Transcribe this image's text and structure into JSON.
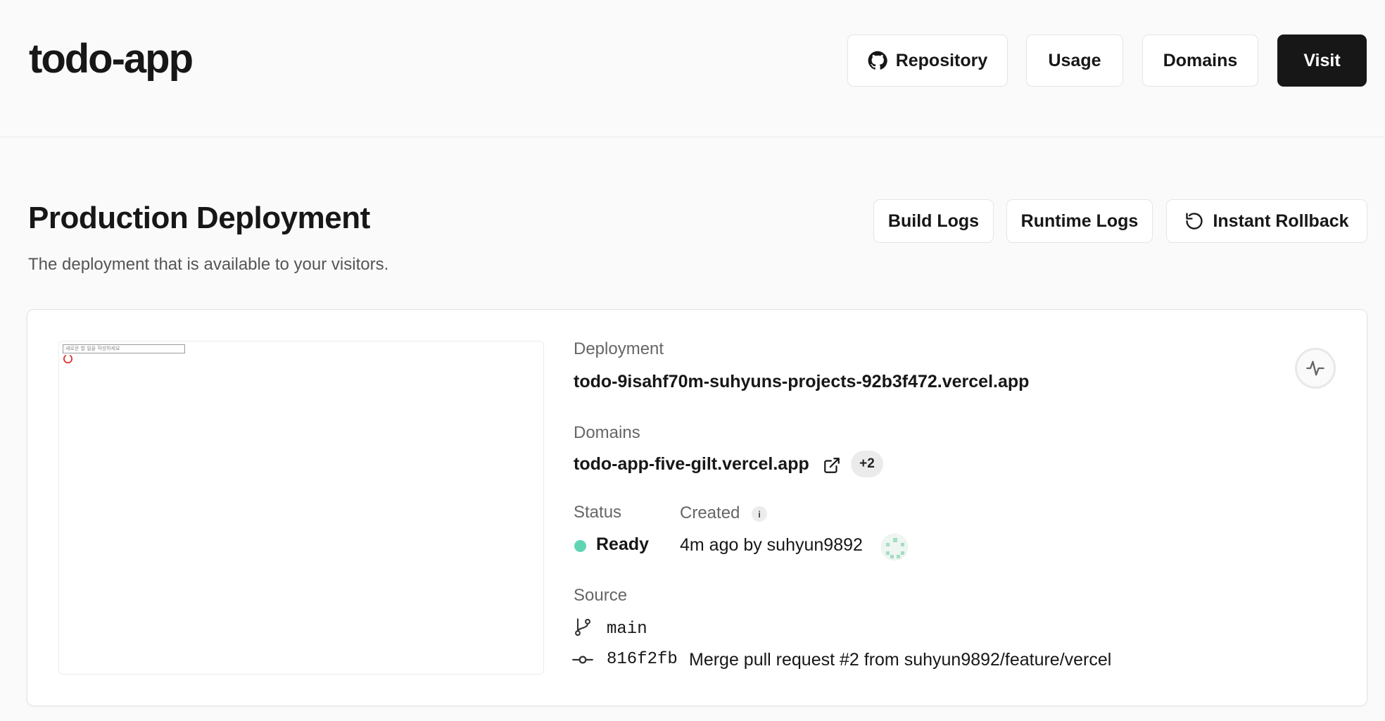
{
  "header": {
    "title": "todo-app",
    "buttons": {
      "repository": "Repository",
      "usage": "Usage",
      "domains": "Domains",
      "visit": "Visit"
    }
  },
  "section": {
    "title": "Production Deployment",
    "subtitle": "The deployment that is available to your visitors.",
    "buttons": {
      "build_logs": "Build Logs",
      "runtime_logs": "Runtime Logs",
      "instant_rollback": "Instant Rollback"
    }
  },
  "preview": {
    "input_placeholder": "새로운 할 일을 작성하세요"
  },
  "deployment": {
    "label": "Deployment",
    "url": "todo-9isahf70m-suhyuns-projects-92b3f472.vercel.app"
  },
  "domains": {
    "label": "Domains",
    "primary": "todo-app-five-gilt.vercel.app",
    "extra_count": "+2"
  },
  "status": {
    "label": "Status",
    "value": "Ready",
    "color": "#5fd5b4"
  },
  "created": {
    "label": "Created",
    "info": "i",
    "value": "4m ago by suhyun9892"
  },
  "source": {
    "label": "Source",
    "branch": "main",
    "commit_hash": "816f2fb",
    "commit_message": "Merge pull request #2 from suhyun9892/feature/vercel"
  }
}
